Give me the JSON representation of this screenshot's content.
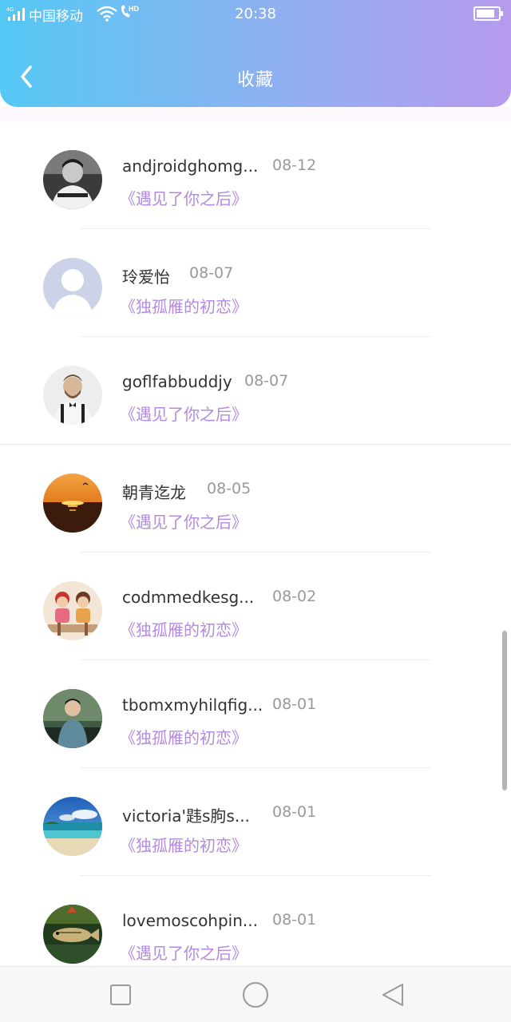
{
  "status_bar": {
    "carrier": "中国移动",
    "time": "20:38",
    "network": "4G",
    "hd": "HD",
    "icons": [
      "signal-icon",
      "wifi-icon",
      "hd-call-icon",
      "battery-icon"
    ]
  },
  "header": {
    "title": "收藏",
    "back_icon": "chevron-left-icon",
    "gradient": [
      "#54c8f5",
      "#b69aee"
    ]
  },
  "favorites": [
    {
      "name": "andjroidghomg...",
      "date": "08-12",
      "work": "《遇见了你之后》",
      "avatar": "avatar-bw-portrait"
    },
    {
      "name": "玲爱怡",
      "date": "08-07",
      "work": "《独孤雁的初恋》",
      "avatar": "avatar-default-placeholder"
    },
    {
      "name": "goflfabbuddjy",
      "date": "08-07",
      "work": "《遇见了你之后》",
      "avatar": "avatar-bearded-man"
    },
    {
      "name": "朝青迄龙",
      "date": "08-05",
      "work": "《遇见了你之后》",
      "avatar": "avatar-sunset-sea"
    },
    {
      "name": "codmmedkesg...",
      "date": "08-02",
      "work": "《独孤雁的初恋》",
      "avatar": "avatar-kids-photo"
    },
    {
      "name": "tbomxmyhilqfig...",
      "date": "08-01",
      "work": "《独孤雁的初恋》",
      "avatar": "avatar-young-man"
    },
    {
      "name": "victoria'韪s朐s...",
      "date": "08-01",
      "work": "《独孤雁的初恋》",
      "avatar": "avatar-beach"
    },
    {
      "name": "lovemoscohpin...",
      "date": "08-01",
      "work": "《遇见了你之后》",
      "avatar": "avatar-fish"
    }
  ],
  "colors": {
    "work_title": "#b38ae0",
    "name": "#333333",
    "date": "#999999"
  },
  "nav": {
    "icons": [
      "recent-apps-icon",
      "home-icon",
      "back-triangle-icon"
    ]
  }
}
